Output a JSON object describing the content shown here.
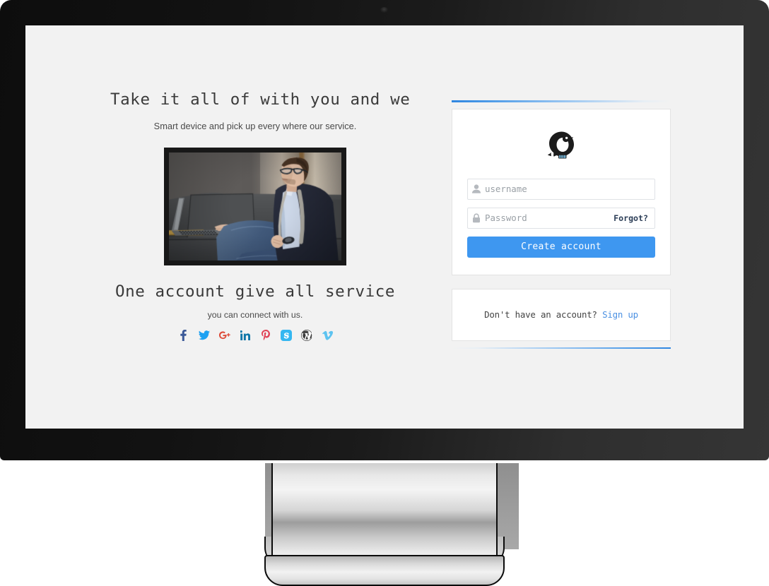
{
  "device": {
    "type": "desktop-monitor",
    "camera_icon": "camera-dot-icon"
  },
  "page": {
    "background_color": "#f2f2f2"
  },
  "left": {
    "headline_top": "Take it all of with you and we",
    "subhead_top": "Smart device and pick up every where our service.",
    "photo_alt": "man-with-glasses-using-laptop-on-couch",
    "headline_bottom": "One account give all service",
    "subhead_bottom": "you can connect with us.",
    "social_links": [
      {
        "name": "facebook-icon",
        "label": "Facebook",
        "color": "#3b5998"
      },
      {
        "name": "twitter-icon",
        "label": "Twitter",
        "color": "#1da1f2"
      },
      {
        "name": "googleplus-icon",
        "label": "Google Plus",
        "color": "#dd4b39"
      },
      {
        "name": "linkedin-icon",
        "label": "LinkedIn",
        "color": "#0e76a8"
      },
      {
        "name": "pinterest-icon",
        "label": "Pinterest",
        "color": "#e04357"
      },
      {
        "name": "skype-icon",
        "label": "Skype",
        "color": "#34b7f1"
      },
      {
        "name": "wordpress-icon",
        "label": "WordPress",
        "color": "#3b3b3b"
      },
      {
        "name": "vimeo-icon",
        "label": "Vimeo",
        "color": "#5dc3f0"
      }
    ]
  },
  "login": {
    "logo_icon": "penguin-bird-logo",
    "accent_color": "#2f86e0",
    "username": {
      "icon": "user-icon",
      "value": "",
      "placeholder": "username"
    },
    "password": {
      "icon": "lock-icon",
      "value": "",
      "placeholder": "Password",
      "forgot_label": "Forgot?"
    },
    "submit_label": "Create account",
    "submit_color": "#3e97f0"
  },
  "signup": {
    "prompt": "Don't have an account?",
    "link_label": "Sign up",
    "link_color": "#4a90e2"
  }
}
